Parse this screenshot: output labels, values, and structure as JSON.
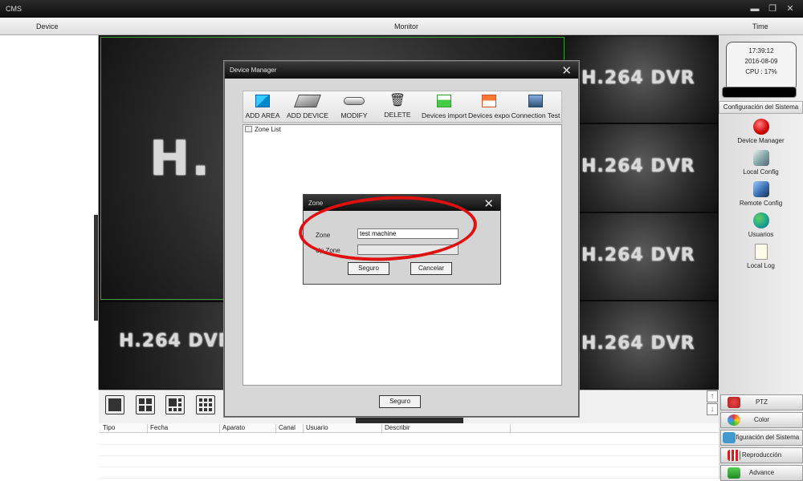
{
  "app": {
    "title": "CMS"
  },
  "menubar": {
    "device": "Device",
    "monitor": "Monitor",
    "time": "Time"
  },
  "clock": {
    "time": "17:39:12",
    "date": "2016-08-09",
    "cpu": "CPU : 17%"
  },
  "video": {
    "watermark": "H.264 DVR",
    "big_watermark": "H."
  },
  "right_panel": {
    "header": "Configuración del Sistema",
    "items": [
      {
        "label": "Device Manager",
        "icon": "red-button-icon"
      },
      {
        "label": "Local Config",
        "icon": "local-config-icon"
      },
      {
        "label": "Remote Config",
        "icon": "remote-config-icon"
      },
      {
        "label": "Usuarios",
        "icon": "users-icon"
      },
      {
        "label": "Local Log",
        "icon": "log-icon"
      }
    ],
    "buttons": [
      {
        "label": "PTZ",
        "icon": "ptz-icon"
      },
      {
        "label": "Color",
        "icon": "color-icon"
      },
      {
        "label": "Configuración del Sistema",
        "icon": "system-config-icon"
      },
      {
        "label": "Reproducción",
        "icon": "playback-icon"
      },
      {
        "label": "Advance",
        "icon": "advance-icon"
      }
    ]
  },
  "log": {
    "columns": [
      "Tipo",
      "Fecha",
      "Aparato",
      "Canal",
      "Usuario",
      "Describir"
    ]
  },
  "device_manager": {
    "title": "Device Manager",
    "tools": [
      {
        "label": "ADD AREA",
        "icon": "add-area-icon"
      },
      {
        "label": "ADD DEVICE",
        "icon": "add-device-icon"
      },
      {
        "label": "MODIFY",
        "icon": "modify-icon"
      },
      {
        "label": "DELETE",
        "icon": "trash-icon"
      },
      {
        "label": "Devices import",
        "icon": "import-icon"
      },
      {
        "label": "Devices expor",
        "icon": "export-icon"
      },
      {
        "label": "Connection  Test",
        "icon": "connection-test-icon"
      }
    ],
    "zone_list": "Zone List",
    "ok": "Seguro"
  },
  "zone_dialog": {
    "title": "Zone",
    "zone_label": "Zone",
    "zone_value": "test machine",
    "upzone_label": "Up Zone",
    "upzone_value": "",
    "ok": "Seguro",
    "cancel": "Cancelar"
  },
  "colors": {
    "selection_border": "#3c9b3c",
    "annotation": "#e01010",
    "titlebar": "#111111"
  }
}
